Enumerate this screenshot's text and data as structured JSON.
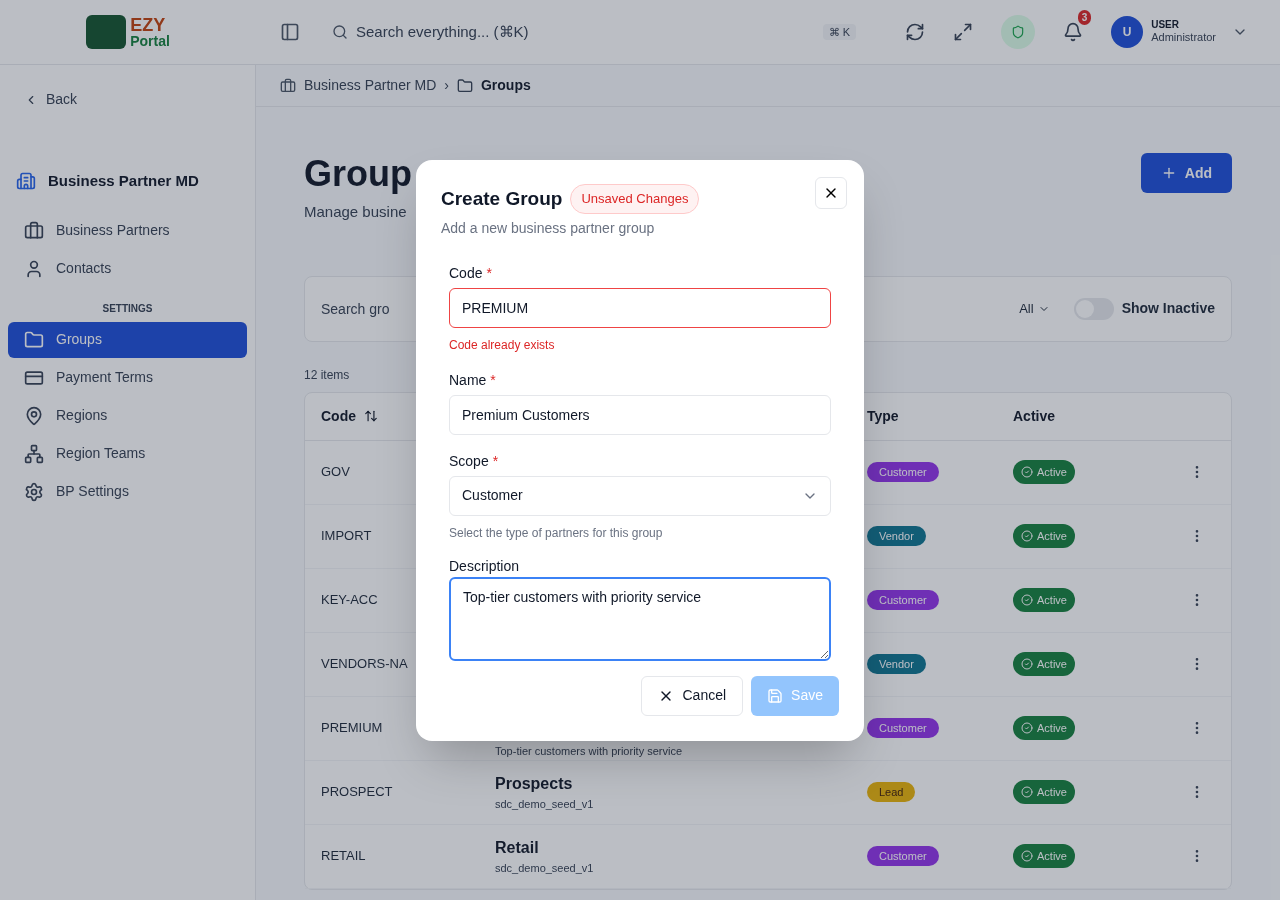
{
  "header": {
    "logo": {
      "top": "EZY",
      "bottom": "Portal"
    },
    "search_placeholder": "Search everything... (⌘K)",
    "shortcut": "⌘ K",
    "notification_count": "3",
    "user": {
      "initial": "U",
      "name": "USER",
      "role": "Administrator"
    }
  },
  "sidebar": {
    "back": "Back",
    "module": "Business Partner MD",
    "items": [
      {
        "kind": "link",
        "label": "Business Partners",
        "selected": false
      },
      {
        "kind": "link",
        "label": "Contacts",
        "selected": false
      },
      {
        "kind": "section",
        "label": "SETTINGS"
      },
      {
        "kind": "link",
        "label": "Groups",
        "selected": true
      },
      {
        "kind": "link",
        "label": "Payment Terms",
        "selected": false
      },
      {
        "kind": "link",
        "label": "Regions",
        "selected": false
      },
      {
        "kind": "link",
        "label": "Region Teams",
        "selected": false
      },
      {
        "kind": "link",
        "label": "BP Settings",
        "selected": false
      }
    ]
  },
  "breadcrumb": {
    "items": [
      "Business Partner MD",
      "Groups"
    ],
    "separator": "›"
  },
  "page": {
    "title": "Group",
    "subtitle": "Manage busine",
    "add_button": "Add"
  },
  "filters": {
    "search_placeholder": "Search gro",
    "scope_filter": "All",
    "show_inactive": {
      "label": "Show Inactive",
      "on": false
    }
  },
  "item_count": "12 items",
  "table": {
    "columns": [
      "Code",
      "Type",
      "Active"
    ],
    "rows": [
      {
        "code": "GOV",
        "type": {
          "kind": "customer",
          "label": "Customer"
        },
        "active": "Active"
      },
      {
        "code": "IMPORT",
        "type": {
          "kind": "vendor",
          "label": "Vendor"
        },
        "active": "Active"
      },
      {
        "code": "KEY-ACC",
        "type": {
          "kind": "customer",
          "label": "Customer"
        },
        "active": "Active"
      },
      {
        "code": "VENDORS-NA",
        "type": {
          "kind": "vendor",
          "label": "Vendor"
        },
        "active": "Active"
      },
      {
        "code": "PREMIUM",
        "description": "Top-tier customers with priority service",
        "type": {
          "kind": "customer",
          "label": "Customer"
        },
        "active": "Active"
      },
      {
        "code": "PROSPECT",
        "name": "Prospects",
        "description": "sdc_demo_seed_v1",
        "type": {
          "kind": "lead",
          "label": "Lead"
        },
        "active": "Active"
      },
      {
        "code": "RETAIL",
        "name": "Retail",
        "description": "sdc_demo_seed_v1",
        "type": {
          "kind": "customer",
          "label": "Customer"
        },
        "active": "Active"
      }
    ]
  },
  "dialog": {
    "title": "Create Group",
    "badge": "Unsaved Changes",
    "subtitle": "Add a new business partner group",
    "fields": [
      {
        "kind": "input",
        "label": "Code",
        "required_mark": "*",
        "value": "PREMIUM",
        "error": "Code already exists"
      },
      {
        "kind": "input",
        "label": "Name",
        "required_mark": "*",
        "value": "Premium Customers"
      },
      {
        "kind": "select",
        "label": "Scope",
        "required_mark": "*",
        "value": "Customer",
        "hint": "Select the type of partners for this group"
      },
      {
        "kind": "textarea",
        "label": "Description",
        "value": "Top-tier customers with priority service",
        "focused": true
      }
    ],
    "cancel": "Cancel",
    "save": {
      "label": "Save",
      "disabled": true
    }
  }
}
